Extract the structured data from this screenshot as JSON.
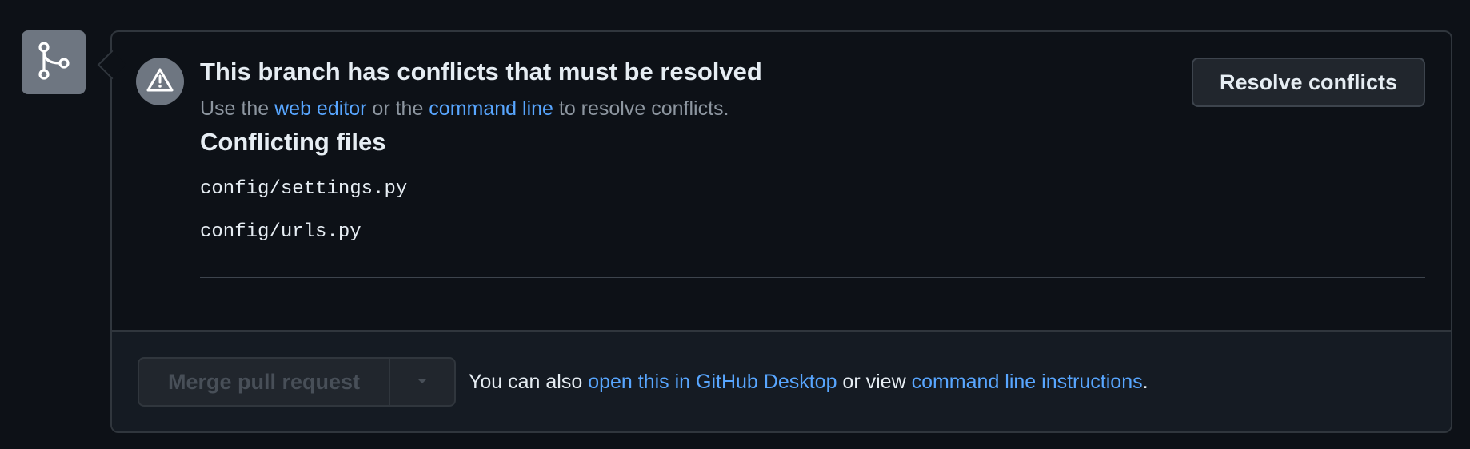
{
  "conflict": {
    "title": "This branch has conflicts that must be resolved",
    "subtitle_prefix": "Use the ",
    "web_editor_link": "web editor",
    "subtitle_middle": " or the ",
    "command_line_link": "command line",
    "subtitle_suffix": " to resolve conflicts.",
    "resolve_button": "Resolve conflicts",
    "files_heading": "Conflicting files",
    "files": [
      "config/settings.py",
      "config/urls.py"
    ]
  },
  "merge": {
    "button_label": "Merge pull request",
    "also_prefix": "You can also ",
    "desktop_link": "open this in GitHub Desktop",
    "also_middle": " or view ",
    "instructions_link": "command line instructions",
    "also_suffix": "."
  },
  "icons": {
    "branch": "git-merge-icon",
    "warning": "alert-triangle-icon",
    "dropdown": "triangle-down-icon"
  },
  "colors": {
    "link": "#58a6ff",
    "panel_bg": "#0d1117",
    "footer_bg": "#151b23",
    "badge_bg": "#6e7681"
  }
}
